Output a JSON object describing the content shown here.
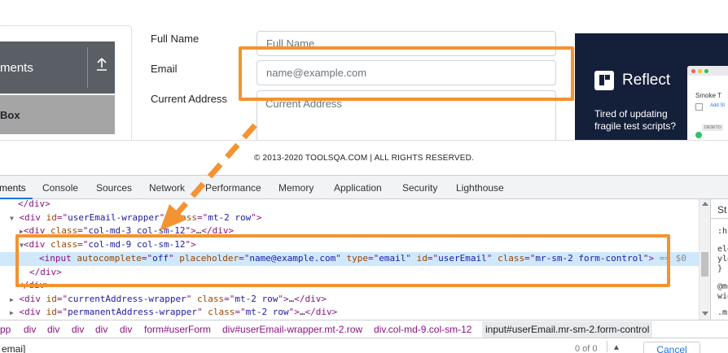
{
  "page": {
    "sidebar": {
      "group_title": "ments",
      "active_item": "Box"
    },
    "form": {
      "full_name_label": "Full Name",
      "full_name_placeholder": "Full Name",
      "email_label": "Email",
      "email_placeholder": "name@example.com",
      "address_label": "Current Address",
      "address_placeholder": "Current Address"
    },
    "ad": {
      "brand": "Reflect",
      "tagline": "Tired of updating fragile test scripts?",
      "mini_title": "Smoke T",
      "mini_link": "Add St",
      "mini_chip": "DESKTO"
    },
    "footer": "© 2013-2020 TOOLSQA.COM | ALL RIGHTS RESERVED."
  },
  "devtools": {
    "tabs": [
      "ments",
      "Console",
      "Sources",
      "Network",
      "Performance",
      "Memory",
      "Application",
      "Security",
      "Lighthouse"
    ],
    "active_tab": "ments",
    "dom": {
      "line0": "</div>",
      "line1_id": "userEmail-wrapper",
      "line1_class": "mt-2 row",
      "line2_class": "col-md-3 col-sm-12",
      "line3_class": "col-md-9 col-sm-12",
      "input_autocomplete": "off",
      "input_placeholder": "name@example.com",
      "input_type": "email",
      "input_id": "userEmail",
      "input_class": "mr-sm-2 form-control",
      "dollar0": "== $0",
      "line5": "</div>",
      "line6": "</div>",
      "line7_id": "currentAddress-wrapper",
      "line7_class": "mt-2 row",
      "line8_id": "permanentAddress-wrapper",
      "line8_class": "mt-2 row",
      "ellipsis": "…"
    },
    "styles": {
      "tab": "St",
      "lines": [
        ":h",
        "ele",
        "yle",
        "}",
        "@me",
        "wid",
        ".m",
        ".m"
      ]
    },
    "breadcrumbs": [
      "pp",
      "div",
      "div",
      "div",
      "div",
      "div",
      "form#userForm",
      "div#userEmail-wrapper.mt-2.row",
      "div.col-md-9.col-sm-12",
      "input#userEmail.mr-sm-2.form-control"
    ],
    "find": {
      "query": "emai]",
      "count": "0 of 0",
      "cancel": "Cancel"
    }
  },
  "colors": {
    "highlight": "#f39331",
    "dom_tag": "#881280",
    "dom_attr_name": "#994500",
    "dom_attr_value": "#1a1aa6",
    "selection": "#cfe8fc"
  }
}
